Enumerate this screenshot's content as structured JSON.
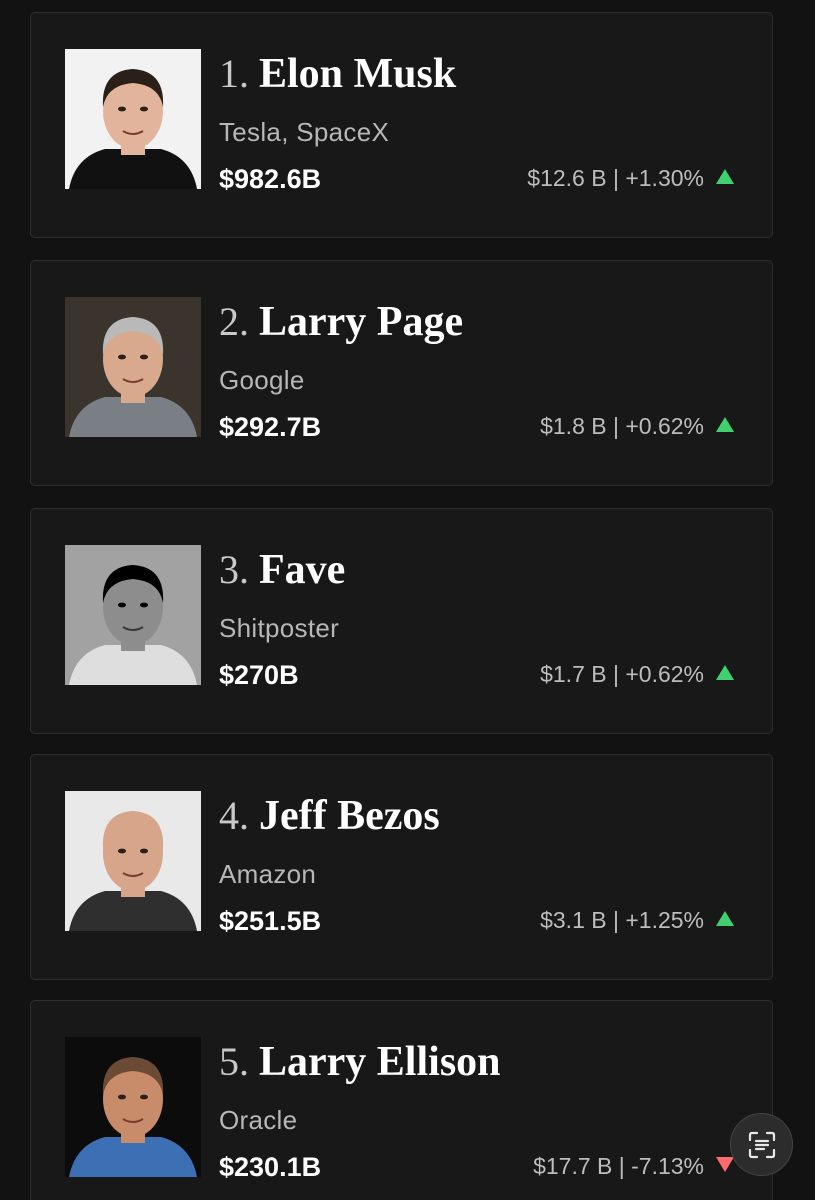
{
  "colors": {
    "background": "#121212",
    "card": "#181818",
    "positive": "#3fd16e",
    "negative": "#ff6b6b"
  },
  "people": [
    {
      "rank": "1.",
      "name": "Elon Musk",
      "source": "Tesla, SpaceX",
      "net_worth": "$982.6B",
      "change": "$12.6 B | +1.30%",
      "direction": "up",
      "photo": {
        "bg": "#f2f2f2",
        "skin": "#e2b49c",
        "hair": "#2a2019",
        "shirt": "#111111",
        "tone": "color"
      }
    },
    {
      "rank": "2.",
      "name": "Larry Page",
      "source": "Google",
      "net_worth": "$292.7B",
      "change": "$1.8 B | +0.62%",
      "direction": "up",
      "photo": {
        "bg": "#3a342c",
        "skin": "#d9a98d",
        "hair": "#b9b9b9",
        "shirt": "#7a7f86",
        "tone": "color"
      }
    },
    {
      "rank": "3.",
      "name": "Fave",
      "source": "Shitposter",
      "net_worth": "$270B",
      "change": "$1.7 B | +0.62%",
      "direction": "up",
      "photo": {
        "bg": "#9a9a9a",
        "skin": "#8a8a8a",
        "hair": "#151515",
        "shirt": "#c8c8c8",
        "tone": "mono"
      }
    },
    {
      "rank": "4.",
      "name": "Jeff Bezos",
      "source": "Amazon",
      "net_worth": "$251.5B",
      "change": "$3.1 B | +1.25%",
      "direction": "up",
      "photo": {
        "bg": "#e9e9e9",
        "skin": "#d7a58a",
        "hair": "#d7a58a",
        "shirt": "#2f2f2f",
        "tone": "color"
      }
    },
    {
      "rank": "5.",
      "name": "Larry Ellison",
      "source": "Oracle",
      "net_worth": "$230.1B",
      "change": "$17.7 B | -7.13%",
      "direction": "down",
      "photo": {
        "bg": "#0c0c0c",
        "skin": "#c98c6a",
        "hair": "#6b4a36",
        "shirt": "#3d6fb5",
        "tone": "color"
      }
    }
  ],
  "scan_button": {
    "icon": "text-scan-icon"
  }
}
